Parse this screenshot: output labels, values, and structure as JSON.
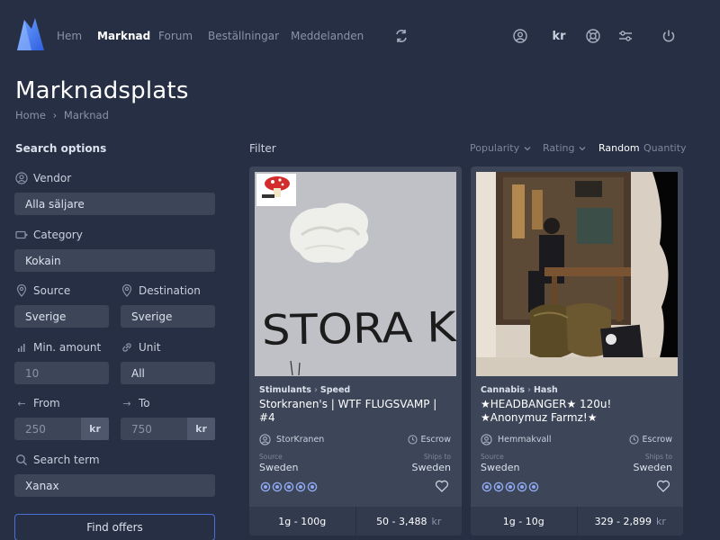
{
  "nav": {
    "links": [
      "Hem",
      "Marknad",
      "Forum",
      "Beställningar",
      "Meddelanden"
    ],
    "active": "Marknad",
    "currency_label": "kr",
    "icons": [
      "refresh-icon",
      "user-circle-icon",
      "currency-kr-icon",
      "support-icon",
      "settings-sliders-icon",
      "power-icon"
    ]
  },
  "header": {
    "title": "Marknadsplats",
    "breadcrumb": [
      "Home",
      "Marknad"
    ]
  },
  "sidebar": {
    "title": "Search options",
    "vendor": {
      "label": "Vendor",
      "value": "Alla säljare"
    },
    "category": {
      "label": "Category",
      "value": "Kokain"
    },
    "source": {
      "label": "Source",
      "value": "Sverige"
    },
    "destination": {
      "label": "Destination",
      "value": "Sverige"
    },
    "min_amount": {
      "label": "Min. amount",
      "value": "10"
    },
    "unit": {
      "label": "Unit",
      "value": "All"
    },
    "price_from": {
      "label": "From",
      "value": "250",
      "currency": "kr"
    },
    "price_to": {
      "label": "To",
      "value": "750",
      "currency": "kr"
    },
    "search_term": {
      "label": "Search term",
      "value": "Xanax"
    },
    "find_button": "Find offers"
  },
  "filter": {
    "label": "Filter",
    "sort_options": [
      {
        "label": "Popularity",
        "active": false,
        "dropdown": true
      },
      {
        "label": "Rating",
        "active": false,
        "dropdown": true
      },
      {
        "label": "Random",
        "active": true,
        "dropdown": false
      },
      {
        "label": "Quantity",
        "active": false,
        "dropdown": false
      }
    ]
  },
  "listings": [
    {
      "category": "Stimulants",
      "subcategory": "Speed",
      "title": "Storkranen's | WTF FLUGSVAMP | #4",
      "image_text": "STORA K",
      "vendor": "StorKranen",
      "escrow": "Escrow",
      "source_label": "Source",
      "source": "Sweden",
      "ships_label": "Ships to",
      "ships_to": "Sweden",
      "rating": 5,
      "quantity_range": "1g - 100g",
      "price_range": "50 - 3,488",
      "currency": "kr"
    },
    {
      "category": "Cannabis",
      "subcategory": "Hash",
      "title": "★HEADBANGER★ 120u! ★Anonymuz Farmz!★",
      "vendor": "Hemmakvall",
      "escrow": "Escrow",
      "source_label": "Source",
      "source": "Sweden",
      "ships_label": "Ships to",
      "ships_to": "Sweden",
      "rating": 5,
      "quantity_range": "1g - 10g",
      "price_range": "329 - 2,899",
      "currency": "kr"
    }
  ],
  "colors": {
    "background": "#262f44",
    "card": "#3d4659",
    "accent": "#4a6fd6",
    "rating_star": "#8fa8f0"
  }
}
